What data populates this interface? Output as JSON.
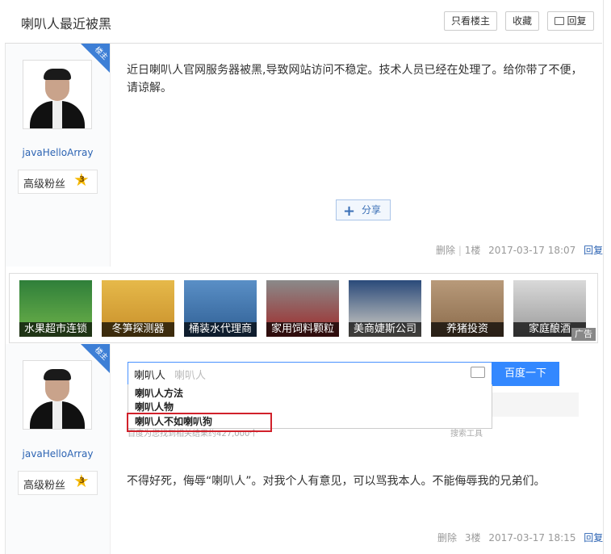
{
  "header": {
    "title": "喇叭人最近被黑",
    "only_op_label": "只看楼主",
    "collect_label": "收藏",
    "reply_label": "回复"
  },
  "posts": [
    {
      "author": "javaHelloArray",
      "badge_label": "高级粉丝",
      "badge_level": "3",
      "op_tag": "楼主",
      "text": "近日喇叭人官网服务器被黑,导致网站访问不稳定。技术人员已经在处理了。给你带了不便，请谅解。",
      "share_label": "分享",
      "delete_label": "删除",
      "floor": "1楼",
      "time": "2017-03-17 18:07",
      "reply_label": "回复"
    },
    {
      "author": "javaHelloArray",
      "badge_label": "高级粉丝",
      "badge_level": "3",
      "op_tag": "楼主",
      "text": "不得好死，侮辱“喇叭人”。对我个人有意见，可以骂我本人。不能侮辱我的兄弟们。",
      "delete_label": "删除",
      "floor": "3楼",
      "time": "2017-03-17 18:15",
      "reply_label": "回复"
    }
  ],
  "ads": {
    "items": [
      "水果超市连锁",
      "冬笋探测器",
      "桶装水代理商",
      "家用饲料颗粒",
      "美商婕斯公司",
      "养猪投资",
      "家庭酿酒"
    ],
    "tag": "广告"
  },
  "search": {
    "typed": "喇叭人",
    "placeholder": "喇叭人",
    "button": "百度一下",
    "suggestions": [
      "喇叭人方法",
      "喇叭人物",
      "喇叭人不如喇叭狗"
    ],
    "faded_result_count": "百度为您找到相关结果约427,000个",
    "faded_tools": "搜索工具"
  },
  "colors": {
    "accent": "#3388ff",
    "link": "#2d64b3",
    "highlight": "#d1212b"
  }
}
